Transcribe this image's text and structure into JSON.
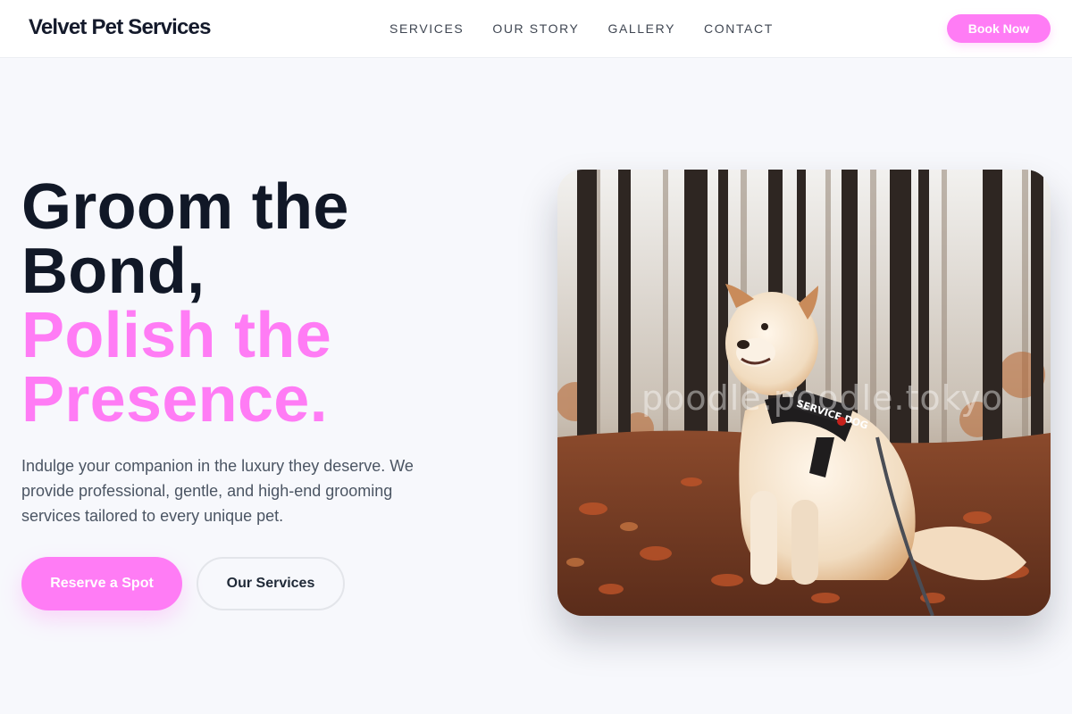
{
  "header": {
    "brand": "Velvet Pet Services",
    "nav": [
      "SERVICES",
      "OUR STORY",
      "GALLERY",
      "CONTACT"
    ],
    "cta_label": "Book Now"
  },
  "hero": {
    "headline_dark": [
      "Groom the",
      "Bond,"
    ],
    "headline_accent": [
      "Polish the",
      "Presence."
    ],
    "description": "Indulge your companion in the luxury they deserve. We provide professional, gentle, and high-end grooming services tailored to every unique pet.",
    "primary_button": "Reserve a Spot",
    "secondary_button": "Our Services",
    "image": {
      "alt": "Service dog sitting in autumn forest leaves",
      "harness_text": "SERVICE DOG",
      "watermark": "poodle.poodle.tokyo"
    }
  },
  "colors": {
    "accent": "#ff7cf5",
    "heading": "#111827",
    "body_text": "#4b5563",
    "background": "#f7f8fc"
  }
}
